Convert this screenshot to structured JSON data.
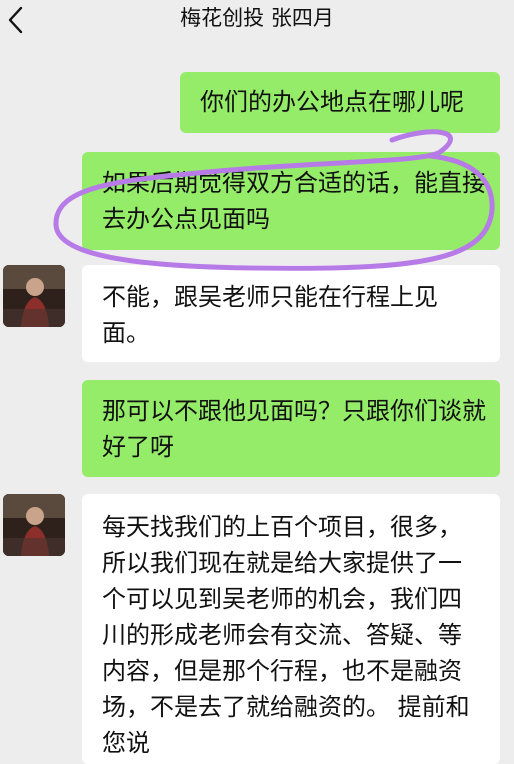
{
  "header": {
    "title": "梅花创投 张四月",
    "back_icon": "chevron-left-icon"
  },
  "messages": [
    {
      "side": "sent",
      "text": "你们的办公地点在哪儿呢"
    },
    {
      "side": "sent",
      "text": "如果后期觉得双方合适的话，能直接去办公点见面吗"
    },
    {
      "side": "received",
      "text": "不能，跟吴老师只能在行程上见面。"
    },
    {
      "side": "sent",
      "text": "那可以不跟他见面吗？只跟你们谈就好了呀"
    },
    {
      "side": "received",
      "text": "每天找我们的上百个项目，很多， 所以我们现在就是给大家提供了一个可以见到吴老师的机会，我们四川的形成老师会有交流、答疑、等内容，但是那个行程，也不是融资场，不是去了就给融资的。 提前和您说"
    }
  ],
  "colors": {
    "background": "#ededed",
    "sent_bubble": "#95ec69",
    "received_bubble": "#ffffff",
    "annotation": "#b77be8"
  }
}
